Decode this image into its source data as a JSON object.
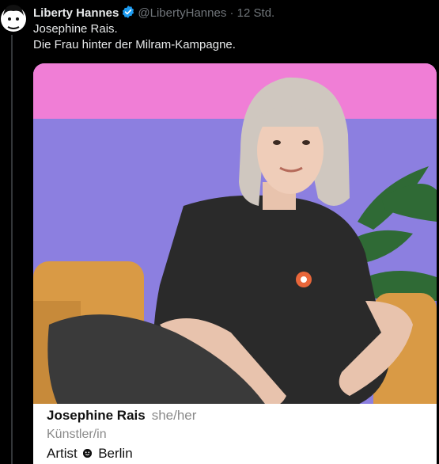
{
  "tweet": {
    "author_name": "Liberty Hannes",
    "handle": "@LibertyHannes",
    "separator": "·",
    "time": "12 Std.",
    "text_lines": [
      "Josephine Rais.",
      "Die Frau hinter der Milram-Kampagne."
    ]
  },
  "card": {
    "name": "Josephine Rais",
    "pronouns": "she/her",
    "role": "Künstler/in",
    "location_prefix": "Artist",
    "location": "Berlin"
  },
  "colors": {
    "background": "#000000",
    "verified": "#1d9bf0",
    "secondary_text": "#71767b",
    "wall_pink": "#f07ed6",
    "wall_purple": "#8c7fe0",
    "sofa": "#d99a45",
    "shirt": "#2a2a2a"
  }
}
